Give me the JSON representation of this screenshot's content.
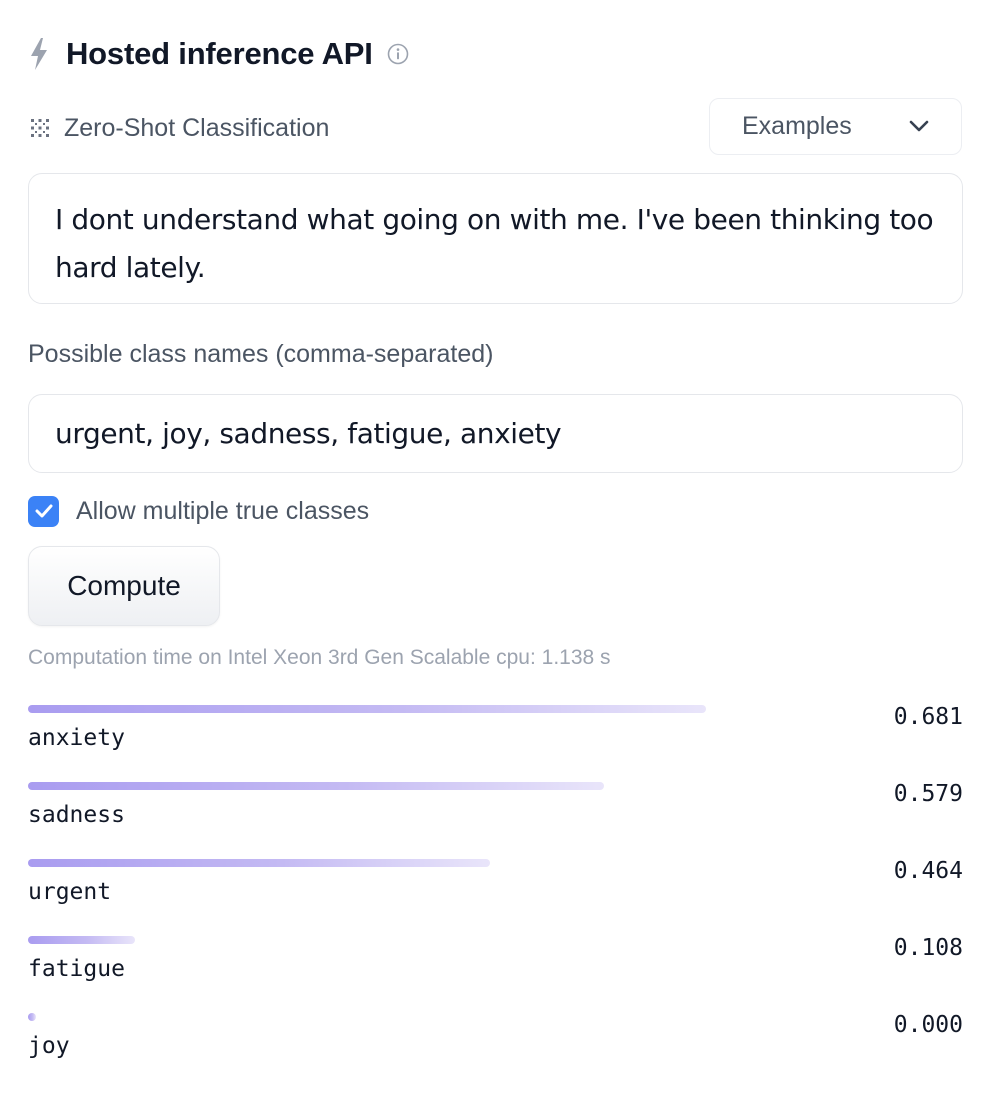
{
  "header": {
    "title": "Hosted inference API",
    "icons": [
      "lightning-icon",
      "info-icon"
    ]
  },
  "task": {
    "label": "Zero-Shot Classification",
    "icon": "grid-dots-icon"
  },
  "examples": {
    "label": "Examples",
    "icon": "chevron-down-icon"
  },
  "input": {
    "text": "I dont understand what going on with me. I've been thinking too hard lately."
  },
  "class_names": {
    "label": "Possible class names (comma-separated)",
    "value": "urgent, joy, sadness, fatigue, anxiety"
  },
  "multi_label": {
    "label": "Allow multiple true classes",
    "checked": true
  },
  "compute": {
    "label": "Compute"
  },
  "timing": {
    "text": "Computation time on Intel Xeon 3rd Gen Scalable cpu: 1.138 s"
  },
  "results": [
    {
      "label": "anxiety",
      "score": "0.681",
      "value": 0.681
    },
    {
      "label": "sadness",
      "score": "0.579",
      "value": 0.579
    },
    {
      "label": "urgent",
      "score": "0.464",
      "value": 0.464
    },
    {
      "label": "fatigue",
      "score": "0.108",
      "value": 0.108
    },
    {
      "label": "joy",
      "score": "0.000",
      "value": 0.0
    }
  ],
  "colors": {
    "accent": "#3b82f6",
    "bar_start": "#a99cf0",
    "bar_end": "#e9e5fa"
  }
}
